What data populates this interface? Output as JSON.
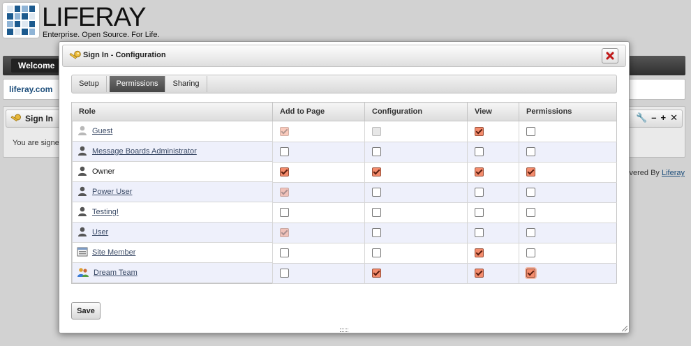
{
  "background": {
    "logo_word": "LIFERAY",
    "logo_tagline": "Enterprise. Open Source. For Life.",
    "nav_welcome": "Welcome",
    "site_name": "liferay.com",
    "portlet_title": "Sign In",
    "portlet_body": "You are signe",
    "powered_by_prefix": "vered By ",
    "powered_by_link": "Liferay"
  },
  "dialog": {
    "title": "Sign In - Configuration",
    "tabs": [
      {
        "label": "Setup",
        "active": false
      },
      {
        "label": "Permissions",
        "active": true
      },
      {
        "label": "Sharing",
        "active": false
      }
    ],
    "columns": [
      "Role",
      "Add to Page",
      "Configuration",
      "View",
      "Permissions"
    ],
    "rows": [
      {
        "role": "Guest",
        "icon": "user-guest-icon",
        "link": true,
        "add_to_page": "checked-disabled",
        "configuration": "unchecked-disabled",
        "view": "checked",
        "permissions": "unchecked"
      },
      {
        "role": "Message Boards Administrator",
        "icon": "user-icon",
        "link": true,
        "add_to_page": "unchecked",
        "configuration": "unchecked",
        "view": "unchecked",
        "permissions": "unchecked"
      },
      {
        "role": "Owner",
        "icon": "user-icon",
        "link": false,
        "add_to_page": "checked",
        "configuration": "checked",
        "view": "checked",
        "permissions": "checked"
      },
      {
        "role": "Power User",
        "icon": "user-icon",
        "link": true,
        "add_to_page": "checked-disabled",
        "configuration": "unchecked",
        "view": "unchecked",
        "permissions": "unchecked"
      },
      {
        "role": "Testing!",
        "icon": "user-icon",
        "link": true,
        "add_to_page": "unchecked",
        "configuration": "unchecked",
        "view": "unchecked",
        "permissions": "unchecked"
      },
      {
        "role": "User",
        "icon": "user-icon",
        "link": true,
        "add_to_page": "checked-disabled",
        "configuration": "unchecked",
        "view": "unchecked",
        "permissions": "unchecked"
      },
      {
        "role": "Site Member",
        "icon": "site-member-icon",
        "link": true,
        "add_to_page": "unchecked",
        "configuration": "unchecked",
        "view": "checked",
        "permissions": "unchecked"
      },
      {
        "role": "Dream Team",
        "icon": "team-icon",
        "link": true,
        "add_to_page": "unchecked",
        "configuration": "checked",
        "view": "checked",
        "permissions": "checked-focus"
      }
    ],
    "save_label": "Save"
  },
  "colors": {
    "checked_fill": "#f48c6d",
    "row_alt": "#eef0fb",
    "active_tab": "#555555",
    "link": "#3a4a66"
  }
}
